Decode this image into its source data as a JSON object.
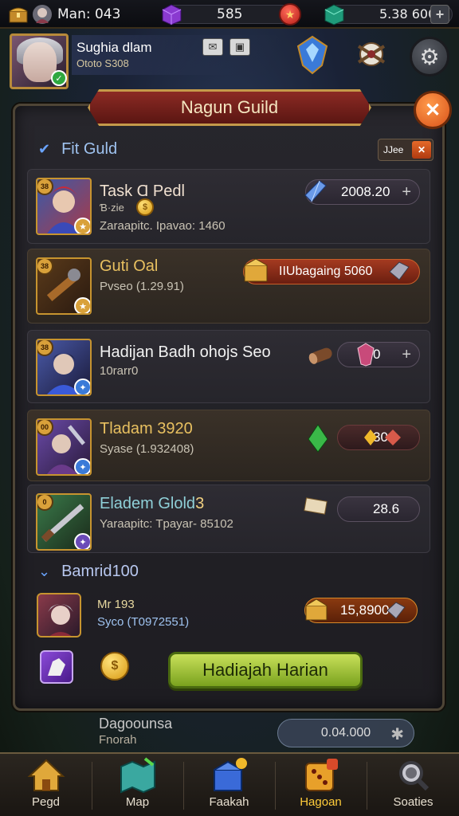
{
  "topbar": {
    "player_label": "Man: 043",
    "currency1": "585",
    "currency2": "5.38 600"
  },
  "profile": {
    "name": "Sughia dlam",
    "subtitle": "Ototo S308"
  },
  "panel": {
    "title": "Nagun Guild",
    "section1": "Fit Guld",
    "tag": "JJee",
    "section2": "Bamrid100"
  },
  "tasks": [
    {
      "title": "Task Ɑ Pedl",
      "line2": "Ɓ·zie",
      "sub": "Zaraapitc. Ipavao: 1460",
      "cost": "2008.20",
      "corner": "38"
    },
    {
      "title": "Guti Oal",
      "sub": "Pvseo (1.29.91)",
      "cost": "IIUbagaing 5060",
      "corner": "38"
    },
    {
      "title": "Hadijan Badh ohojs Seo",
      "sub": "10rarr0",
      "cost": "0",
      "corner": "38"
    },
    {
      "title": "Tladam 3920",
      "sub": "Syase (1.932408)",
      "cost": "30",
      "corner": "00"
    },
    {
      "title": "Eladem Glold",
      "title_suffix": "3",
      "sub": "Yaraapitc: Tpayar- 85102",
      "cost": "28.6",
      "corner": "0"
    }
  ],
  "reward": {
    "title": "Mr 193",
    "sub": "Syco (T0972551)",
    "cost": "15,8900",
    "claim_label": "Hadiajah Harian"
  },
  "below": {
    "title": "Dagoounsa",
    "sub": "Fnorah",
    "value": "0.04.000"
  },
  "nav": [
    {
      "label": "Pegd",
      "icon": "house-icon"
    },
    {
      "label": "Map",
      "icon": "map-icon"
    },
    {
      "label": "Faakah",
      "icon": "chest-icon"
    },
    {
      "label": "Hagoan",
      "icon": "dice-icon"
    },
    {
      "label": "Soaties",
      "icon": "magnifier-icon"
    }
  ],
  "colors": {
    "accent_gold": "#c59a4a",
    "claim_green": "#9cc43a",
    "active_nav": "#ffcc3a",
    "title_red": "#8c2a24"
  }
}
